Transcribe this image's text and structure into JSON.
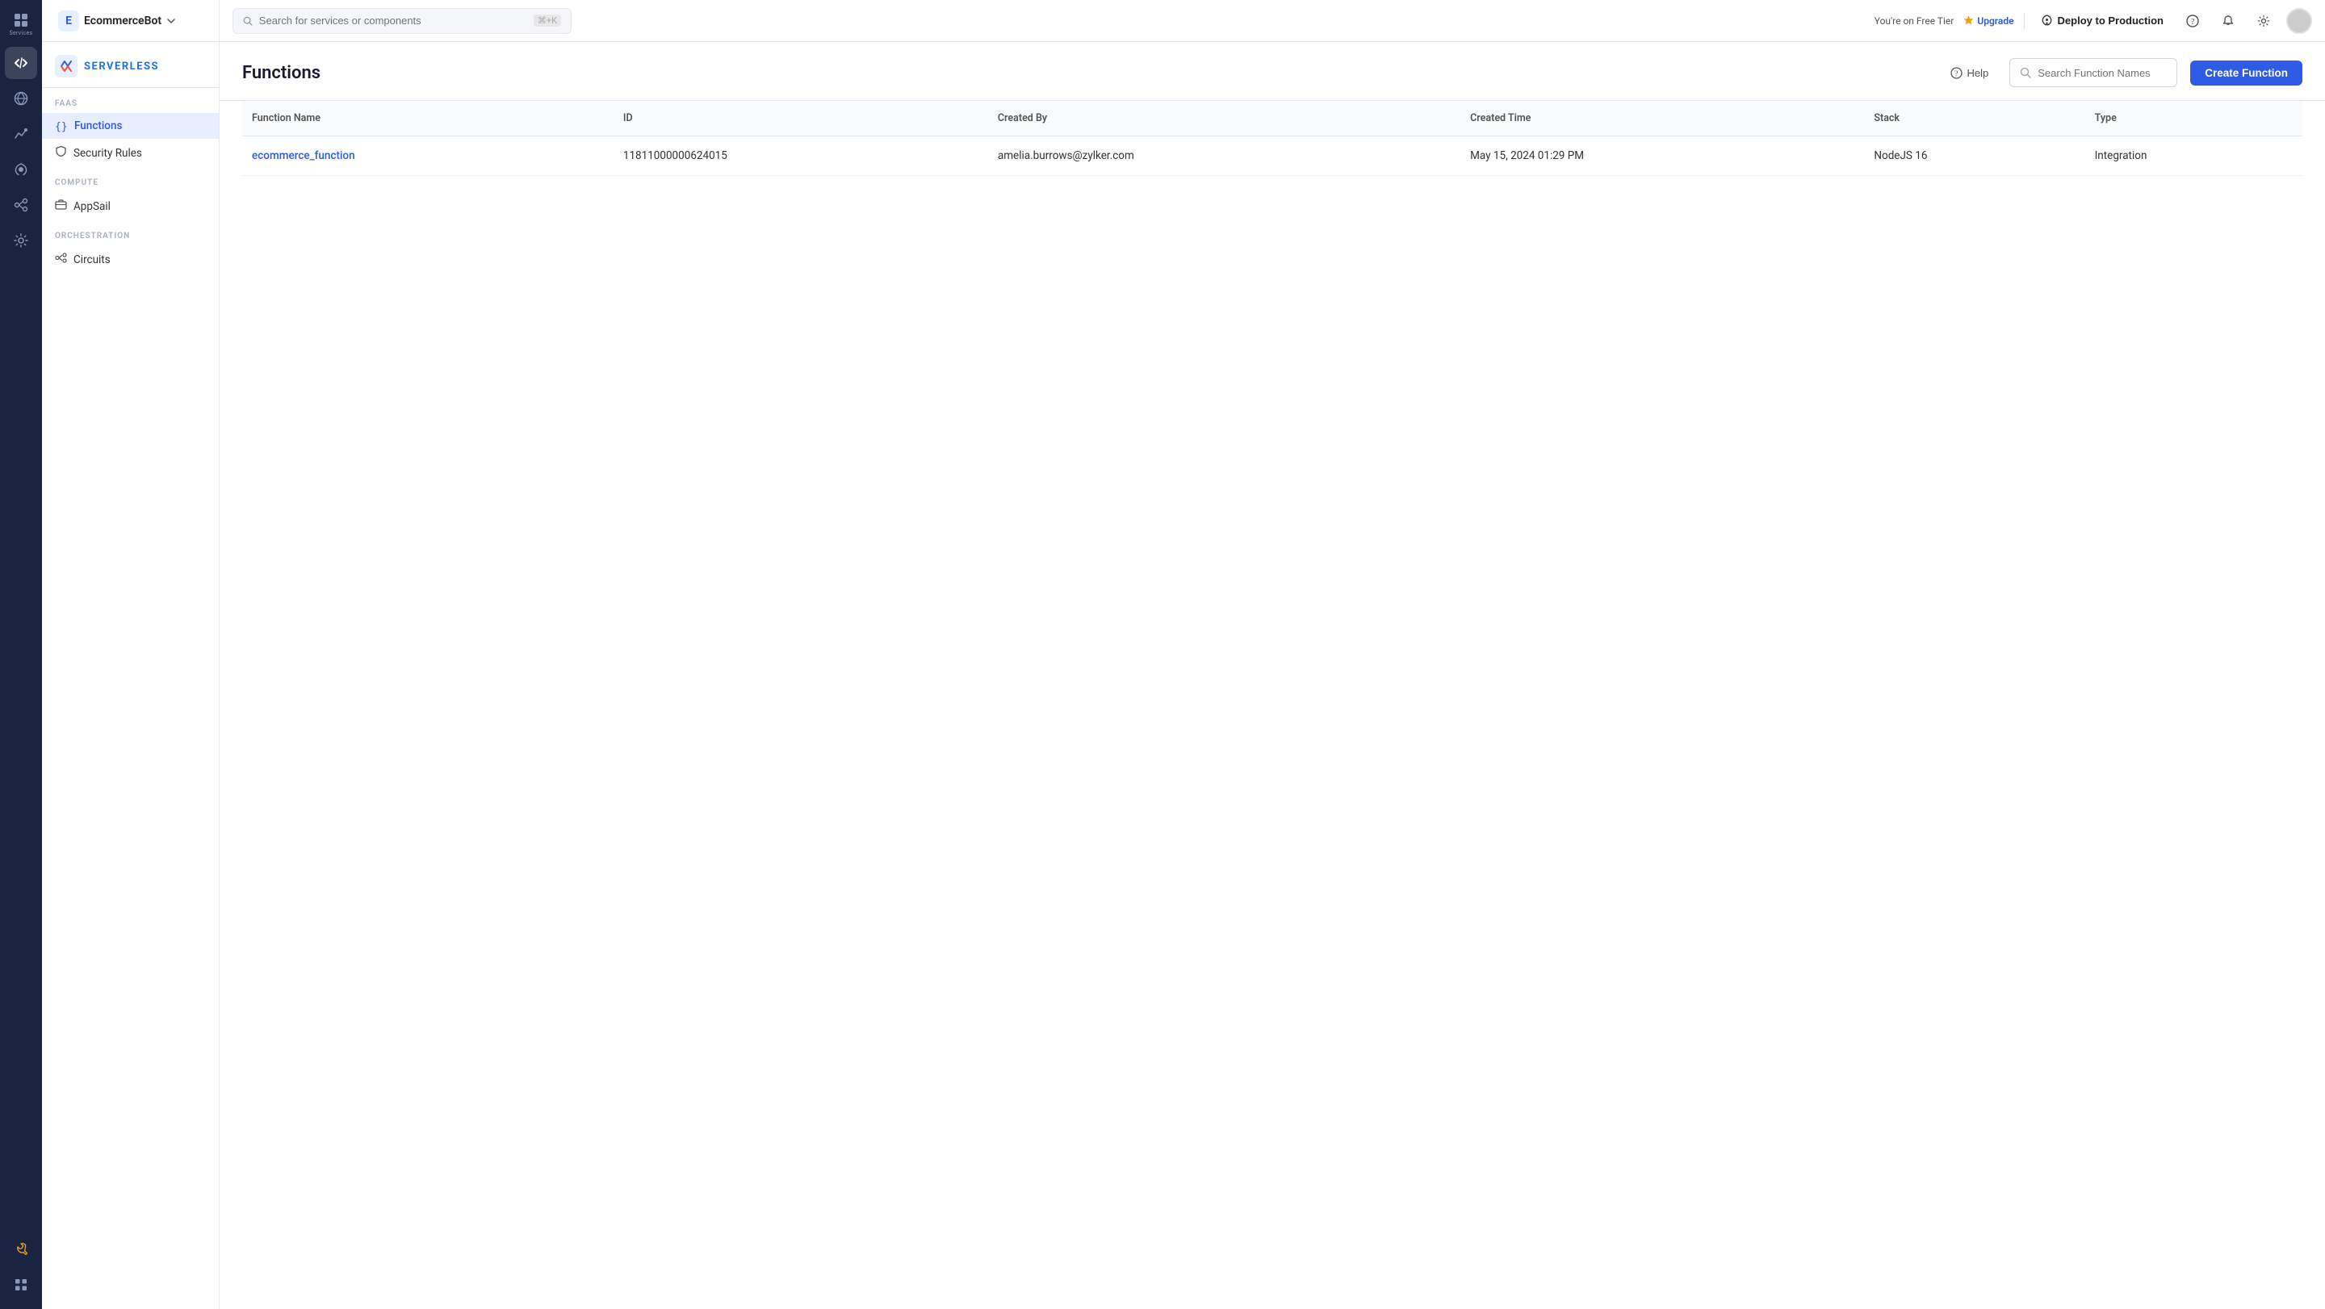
{
  "app": {
    "name": "EcommerceBot",
    "initial": "E"
  },
  "topbar": {
    "search_placeholder": "Search for services or components",
    "search_shortcut": "⌘+K",
    "tier_text": "You're on Free Tier",
    "upgrade_label": "Upgrade",
    "deploy_label": "Deploy to Production"
  },
  "sidebar": {
    "brand": "SERVERLESS",
    "sections": [
      {
        "label": "FAAS",
        "items": [
          {
            "id": "functions",
            "label": "Functions",
            "active": true
          },
          {
            "id": "security-rules",
            "label": "Security Rules",
            "active": false
          }
        ]
      },
      {
        "label": "COMPUTE",
        "items": [
          {
            "id": "appsail",
            "label": "AppSail",
            "active": false
          }
        ]
      },
      {
        "label": "ORCHESTRATION",
        "items": [
          {
            "id": "circuits",
            "label": "Circuits",
            "active": false
          }
        ]
      }
    ]
  },
  "nav_rail": {
    "items": [
      {
        "id": "services",
        "label": "Services",
        "active": false
      },
      {
        "id": "code",
        "label": "",
        "active": true
      },
      {
        "id": "data",
        "label": "",
        "active": false
      },
      {
        "id": "analytics",
        "label": "",
        "active": false
      },
      {
        "id": "api",
        "label": "",
        "active": false
      },
      {
        "id": "integrations",
        "label": "",
        "active": false
      },
      {
        "id": "settings2",
        "label": "",
        "active": false
      }
    ],
    "bottom": [
      {
        "id": "tools",
        "label": ""
      },
      {
        "id": "grid",
        "label": ""
      }
    ]
  },
  "page": {
    "title": "Functions",
    "help_label": "Help",
    "search_placeholder": "Search Function Names",
    "create_button": "Create Function"
  },
  "table": {
    "columns": [
      "Function Name",
      "ID",
      "Created By",
      "Created Time",
      "Stack",
      "Type"
    ],
    "rows": [
      {
        "function_name": "ecommerce_function",
        "id": "11811000000624015",
        "created_by": "amelia.burrows@zylker.com",
        "created_time": "May 15, 2024 01:29 PM",
        "stack": "NodeJS 16",
        "type": "Integration"
      }
    ]
  },
  "colors": {
    "accent": "#2d5be3",
    "nav_bg": "#1a2340",
    "link": "#2d5be3"
  }
}
